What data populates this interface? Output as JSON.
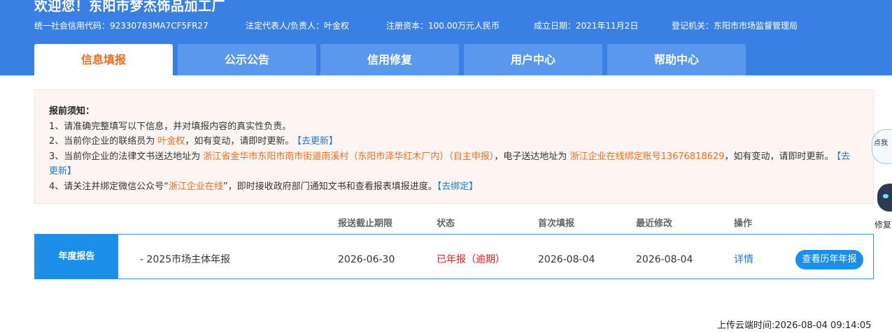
{
  "header": {
    "title": "欢迎您！东阳市梦杰饰品加工厂",
    "credit_code": "统一社会信用代码：92330783MA7CF5FR27",
    "legal_rep": "法定代表人/负责人：叶金权",
    "capital": "注册资本：100.00万元人民币",
    "established": "成立日期：2021年11月2日",
    "authority": "登记机关：东阳市市场监督管理局"
  },
  "tabs": [
    {
      "label": "信息填报",
      "active": true
    },
    {
      "label": "公示公告",
      "active": false
    },
    {
      "label": "信用修复",
      "active": false
    },
    {
      "label": "用户中心",
      "active": false
    },
    {
      "label": "帮助中心",
      "active": false
    }
  ],
  "notice": {
    "title": "报前须知：",
    "line1": "1、请准确完整填写以下信息，并对填报内容的真实性负责。",
    "line2_pre": "2、当前你企业的联络员为 ",
    "liaison": "叶金权",
    "line2_post": "，如有变动，请即时更新。",
    "update_link": "【去更新】",
    "line3_pre": "3、当前你企业的法律文书送达地址为 ",
    "service_address": "浙江省金华市东阳市南市街道南溪村（东阳市泽华红木厂内）（自主申报）",
    "line3_mid": "，电子送达地址为 ",
    "e_address": "浙江企业在线绑定账号13676818629",
    "line3_post": "，如有变动，请即时更新。",
    "update_link2": "【去更新】",
    "line4_pre": "4、请关注并绑定微信公众号“",
    "wechat": "浙江企业在线",
    "line4_post": "”，即时接收政府部门通知文书和查看报表填报进度。",
    "bind_link": "【去绑定】"
  },
  "table": {
    "headers": [
      "报送截止期限",
      "状态",
      "首次填报",
      "最近修改",
      "操作"
    ],
    "section_label": "年度报告",
    "row": {
      "name": "- 2025市场主体年报",
      "deadline": "2026-06-30",
      "status": "已年报（逾期）",
      "first_filed": "2026-08-04",
      "last_modified": "2026-08-04",
      "detail_link": "详情",
      "history_button": "查看历年年报"
    }
  },
  "footer": {
    "upload_time": "上传云端时间:2026-08-04 09:14:05"
  },
  "side_widget": {
    "bubble_text": "点我",
    "label": "修复"
  },
  "colors": {
    "header_bg": "#3a80e4",
    "accent_orange": "#f26b1d",
    "accent_blue": "#1c8fe8",
    "status_red": "#e02020"
  }
}
